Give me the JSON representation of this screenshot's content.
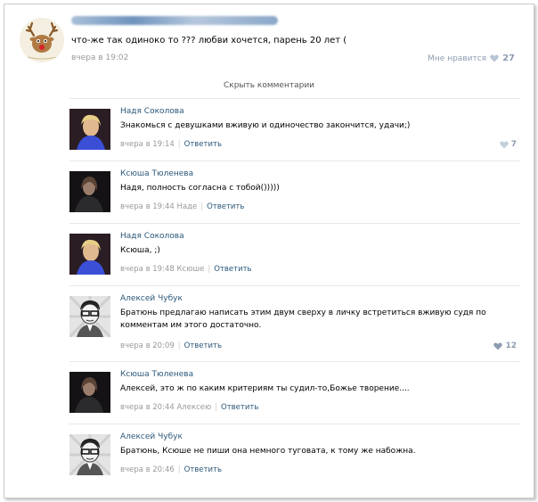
{
  "post": {
    "text": "что-же так одиноко то ??? любви хочется, парень 20 лет (",
    "time": "вчера в 19:02",
    "like_label": "Мне нравится",
    "like_count": "27"
  },
  "hide_comments": "Скрыть комментарии",
  "comments": [
    {
      "author": "Надя Соколова",
      "text": "Знакомься с девушками вживую и одиночество закончится, удачи;)",
      "time": "вчера в 19:14",
      "reply_to": "",
      "reply_label": "Ответить",
      "likes": "7"
    },
    {
      "author": "Ксюша Тюленева",
      "text": "Надя, полность согласна с тобой()))))",
      "time": "вчера в 19:44",
      "reply_to": "Наде",
      "reply_label": "Ответить",
      "likes": ""
    },
    {
      "author": "Надя Соколова",
      "text": "Ксюша, ;)",
      "time": "вчера в 19:48",
      "reply_to": "Ксюше",
      "reply_label": "Ответить",
      "likes": ""
    },
    {
      "author": "Алексей Чубук",
      "text": "Братюнь предлагаю написать этим двум сверху в личку встретиться вживую судя по комментам им этого достаточно.",
      "time": "вчера в 20:09",
      "reply_to": "",
      "reply_label": "Ответить",
      "likes": "12"
    },
    {
      "author": "Ксюша Тюленева",
      "text": "Алексей, это ж по каким критериям ты судил-то,Божье творение....",
      "time": "вчера в 20:44",
      "reply_to": "Алексею",
      "reply_label": "Ответить",
      "likes": ""
    },
    {
      "author": "Алексей Чубук",
      "text": "Братюнь, Ксюше не пиши она немного туговата, к тому же набожна.",
      "time": "вчера в 20:46",
      "reply_to": "",
      "reply_label": "Ответить",
      "likes": ""
    }
  ],
  "icons": {
    "like": "heart-icon",
    "post_avatar": "deer-avatar"
  },
  "colors": {
    "link": "#2b587a",
    "muted": "#999999",
    "like": "#8e9db2",
    "divider": "#e7e8ec"
  }
}
